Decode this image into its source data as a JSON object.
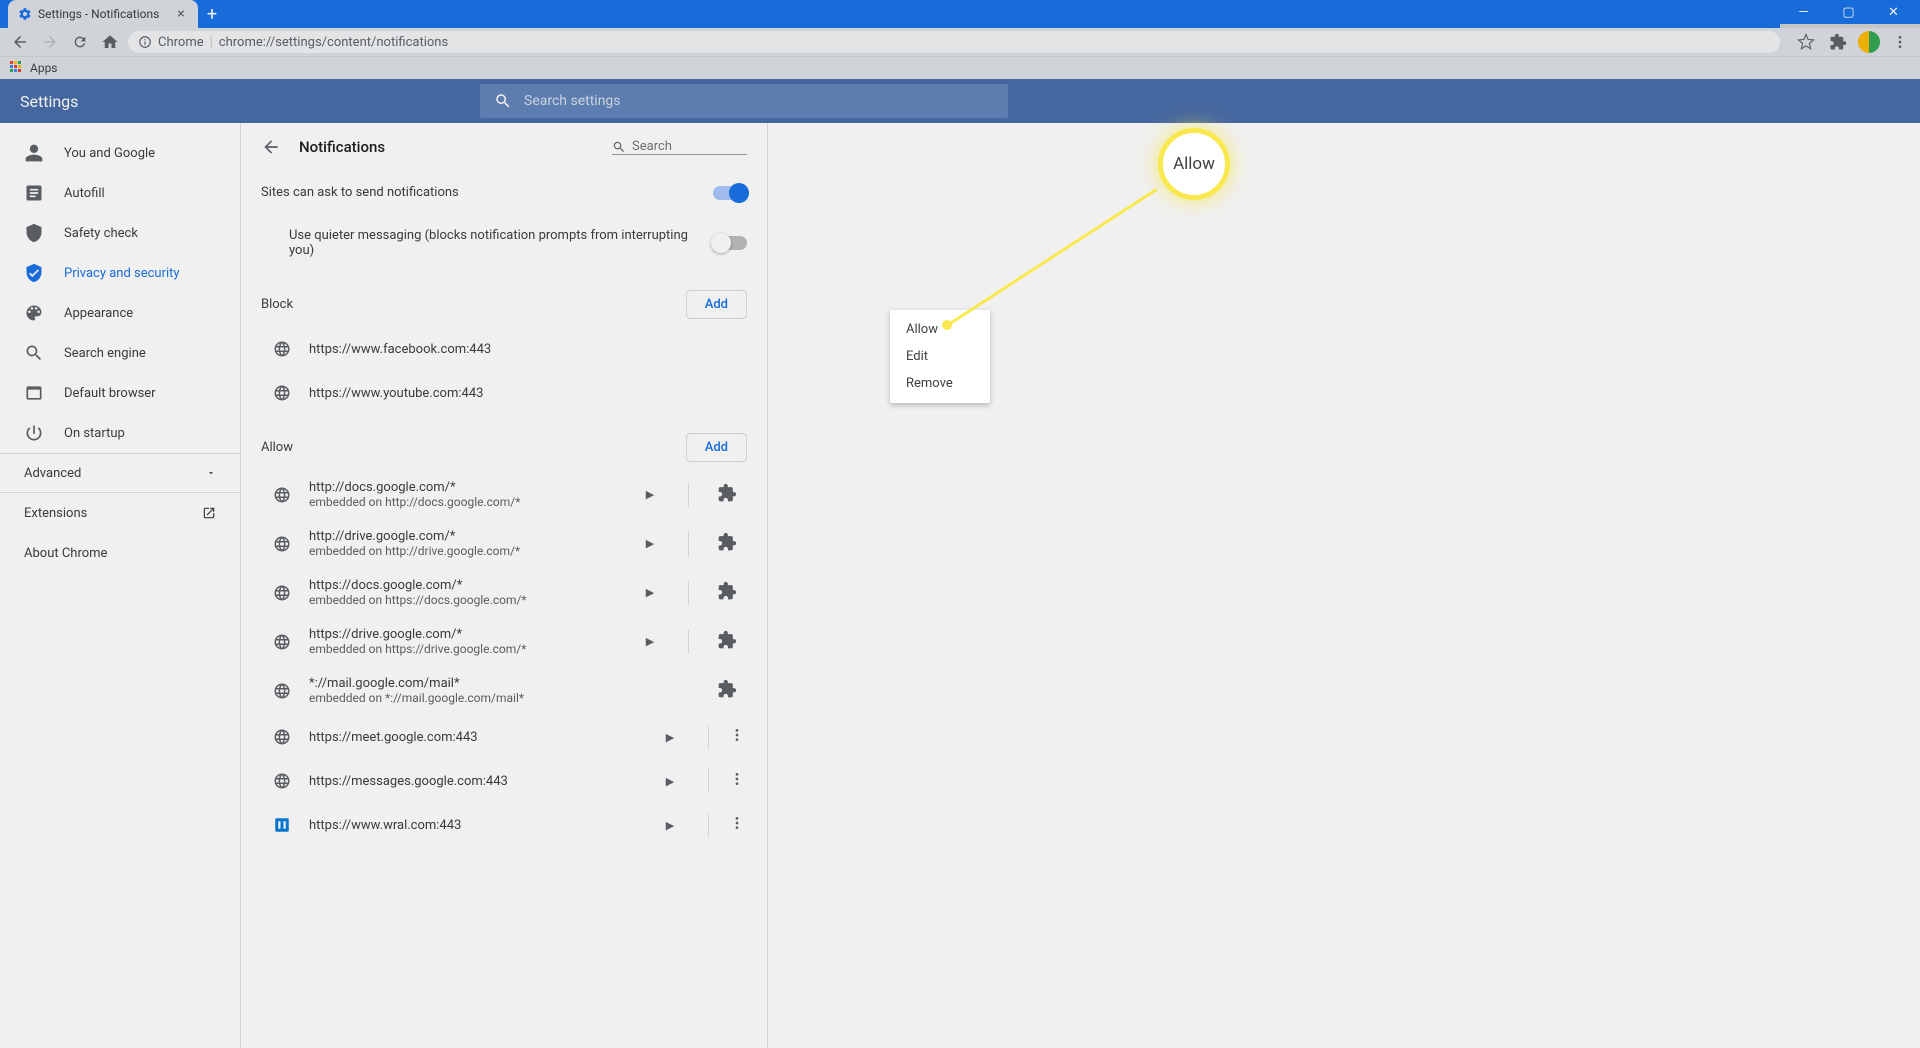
{
  "window": {
    "tab_title": "Settings - Notifications",
    "new_tab": "+",
    "minimize": "—",
    "maximize": "▢",
    "close": "✕"
  },
  "toolbar": {
    "chrome_label": "Chrome",
    "url": "chrome://settings/content/notifications",
    "apps_label": "Apps"
  },
  "header": {
    "title": "Settings",
    "search_placeholder": "Search settings"
  },
  "sidebar": {
    "items": [
      {
        "label": "You and Google"
      },
      {
        "label": "Autofill"
      },
      {
        "label": "Safety check"
      },
      {
        "label": "Privacy and security"
      },
      {
        "label": "Appearance"
      },
      {
        "label": "Search engine"
      },
      {
        "label": "Default browser"
      },
      {
        "label": "On startup"
      }
    ],
    "advanced": "Advanced",
    "extensions": "Extensions",
    "about": "About Chrome"
  },
  "page": {
    "title": "Notifications",
    "search_placeholder": "Search",
    "ask_label": "Sites can ask to send notifications",
    "quieter_label": "Use quieter messaging (blocks notification prompts from interrupting you)",
    "block_label": "Block",
    "allow_label": "Allow",
    "add_label": "Add",
    "block_sites": [
      {
        "url": "https://www.facebook.com:443"
      },
      {
        "url": "https://www.youtube.com:443"
      }
    ],
    "allow_sites": [
      {
        "url": "http://docs.google.com/*",
        "sub": "embedded on http://docs.google.com/*",
        "ext": true
      },
      {
        "url": "http://drive.google.com/*",
        "sub": "embedded on http://drive.google.com/*",
        "ext": true
      },
      {
        "url": "https://docs.google.com/*",
        "sub": "embedded on https://docs.google.com/*",
        "ext": true
      },
      {
        "url": "https://drive.google.com/*",
        "sub": "embedded on https://drive.google.com/*",
        "ext": true
      },
      {
        "url": "*://mail.google.com/mail*",
        "sub": "embedded on *://mail.google.com/mail*",
        "ext": true,
        "noarrow": true
      },
      {
        "url": "https://meet.google.com:443"
      },
      {
        "url": "https://messages.google.com:443"
      },
      {
        "url": "https://www.wral.com:443",
        "special": true
      }
    ],
    "context": {
      "allow": "Allow",
      "edit": "Edit",
      "remove": "Remove"
    }
  },
  "callout": {
    "label": "Allow"
  }
}
